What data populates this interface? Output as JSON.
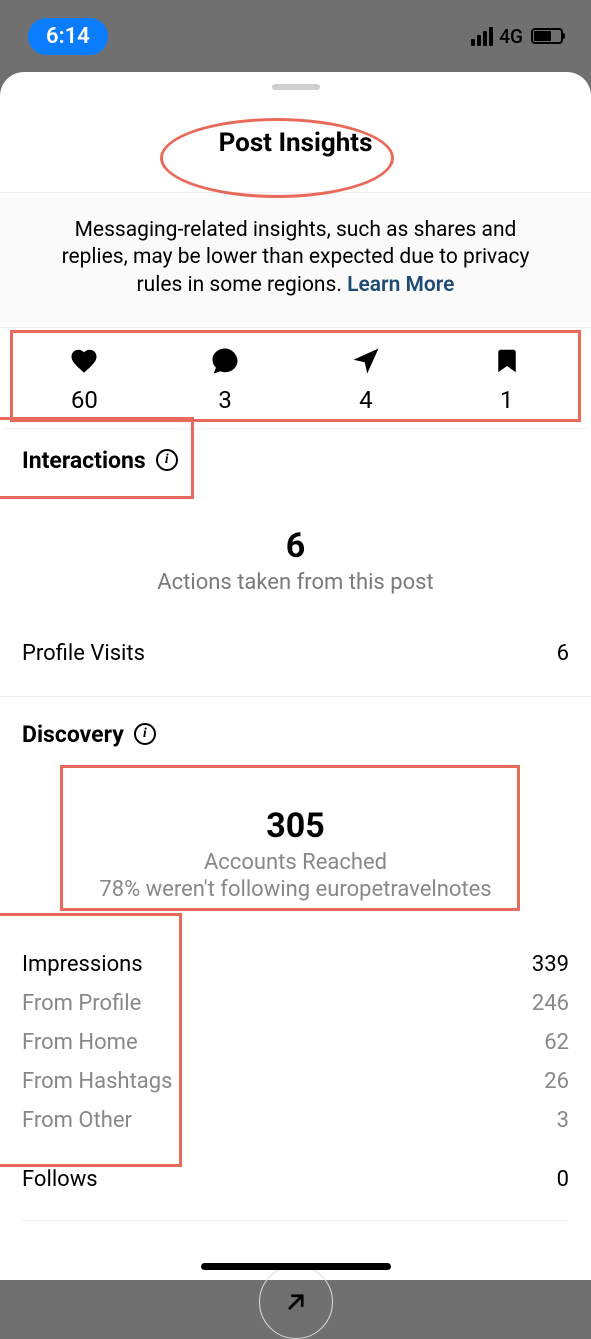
{
  "status_bar": {
    "time": "6:14",
    "network": "4G"
  },
  "header": {
    "title": "Post Insights"
  },
  "notice": {
    "text": "Messaging-related insights, such as shares and replies, may be lower than expected due to privacy rules in some regions. ",
    "link_label": "Learn More"
  },
  "engagement": {
    "likes": "60",
    "comments": "3",
    "shares": "4",
    "saves": "1"
  },
  "interactions": {
    "label": "Interactions",
    "total": "6",
    "subtitle": "Actions taken from this post",
    "profile_visits_label": "Profile Visits",
    "profile_visits_value": "6"
  },
  "discovery": {
    "label": "Discovery",
    "accounts_reached_value": "305",
    "accounts_reached_label": "Accounts Reached",
    "not_following_text": "78% weren't following europetravelnotes",
    "impressions_label": "Impressions",
    "impressions_value": "339",
    "sources": [
      {
        "label": "From Profile",
        "value": "246"
      },
      {
        "label": "From Home",
        "value": "62"
      },
      {
        "label": "From Hashtags",
        "value": "26"
      },
      {
        "label": "From Other",
        "value": "3"
      }
    ],
    "follows_label": "Follows",
    "follows_value": "0"
  }
}
